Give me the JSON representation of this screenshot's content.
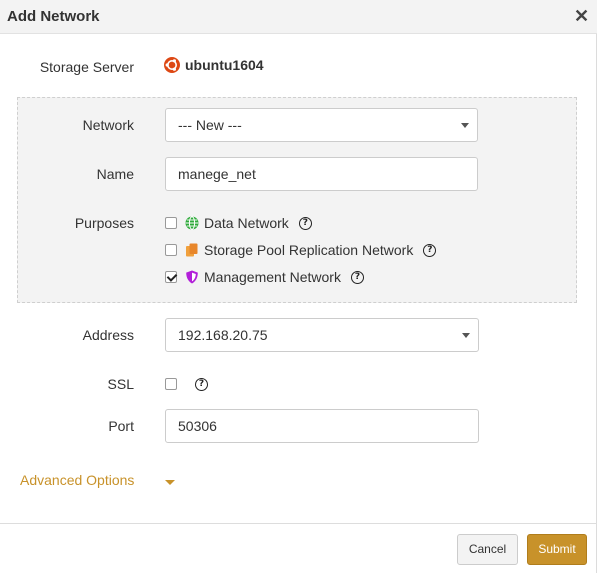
{
  "dialog": {
    "title": "Add Network",
    "close_glyph": "✕"
  },
  "form": {
    "storage_server": {
      "label": "Storage Server",
      "value": "ubuntu1604",
      "icon": "ubuntu-logo-icon"
    },
    "network": {
      "label": "Network",
      "selected": "--- New ---"
    },
    "name": {
      "label": "Name",
      "value": "manege_net"
    },
    "purposes": {
      "label": "Purposes",
      "items": [
        {
          "label": "Data Network",
          "checked": false,
          "icon": "globe-icon"
        },
        {
          "label": "Storage Pool Replication Network",
          "checked": false,
          "icon": "copy-icon"
        },
        {
          "label": "Management Network",
          "checked": true,
          "icon": "shield-icon"
        }
      ]
    },
    "address": {
      "label": "Address",
      "selected": "192.168.20.75"
    },
    "ssl": {
      "label": "SSL",
      "checked": false
    },
    "port": {
      "label": "Port",
      "value": "50306"
    },
    "advanced_options": "Advanced Options"
  },
  "footer": {
    "cancel_label": "Cancel",
    "submit_label": "Submit"
  },
  "colors": {
    "accent": "#c8922a",
    "header_bg": "#f3f3f3",
    "globe": "#2eaa3a",
    "copy": "#e8862a",
    "shield": "#b21fd9",
    "ubuntu": "#dd4814"
  }
}
